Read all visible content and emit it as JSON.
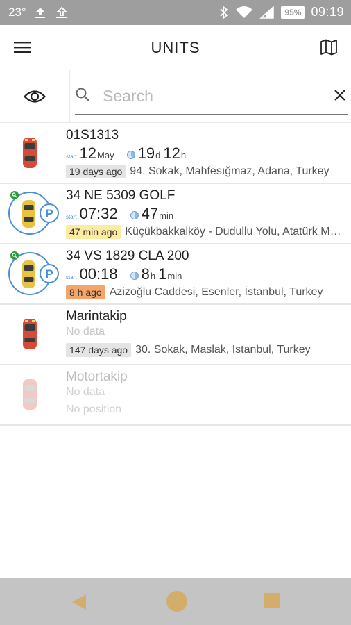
{
  "status_bar": {
    "temperature": "23°",
    "battery": "95%",
    "time": "09:19"
  },
  "app_bar": {
    "title": "UNITS",
    "menu_icon": "hamburger-menu-icon",
    "map_icon": "map-icon"
  },
  "search": {
    "placeholder": "Search",
    "value": "",
    "visibility_icon": "eye-icon",
    "search_icon": "search-icon",
    "clear_icon": "close-icon"
  },
  "units": [
    {
      "name": "01S1313",
      "start_label": "start",
      "start_main": "12",
      "start_sub": "May",
      "dur_main1": "19",
      "dur_sub1": "d",
      "dur_main2": "12",
      "dur_sub2": "h",
      "age": "19 days ago",
      "age_style": "neutral",
      "address": "94. Sokak, Mahfesığmaz, Adana, Turkey",
      "car_color": "red",
      "parked": false
    },
    {
      "name": "34 NE 5309 GOLF",
      "start_label": "start",
      "start_main": "07:32",
      "start_sub": "",
      "dur_main1": "47",
      "dur_sub1": "min",
      "dur_main2": "",
      "dur_sub2": "",
      "age": "47 min ago",
      "age_style": "warn",
      "address": "Küçükbakkalköy - Dudullu Yolu, Atatürk Mahallesi",
      "car_color": "yellow",
      "parked": true
    },
    {
      "name": "34 VS 1829 CLA 200",
      "start_label": "start",
      "start_main": "00:18",
      "start_sub": "",
      "dur_main1": "8",
      "dur_sub1": "h",
      "dur_main2": "1",
      "dur_sub2": "min",
      "age": "8 h ago",
      "age_style": "alert",
      "address": "Azizoğlu Caddesi, Esenler, İstanbul, Turkey",
      "car_color": "yellow",
      "parked": true
    },
    {
      "name": "Marintakip",
      "no_data": "No data",
      "age": "147 days ago",
      "age_style": "neutral",
      "address": "30. Sokak, Maslak, İstanbul, Turkey",
      "car_color": "red",
      "parked": false
    },
    {
      "name": "Motortakip",
      "no_data": "No data",
      "no_position": "No position",
      "car_color": "pale",
      "parked": false
    }
  ],
  "nav_bar": {
    "back_icon": "back-triangle-icon",
    "home_icon": "home-circle-icon",
    "recent_icon": "recent-square-icon"
  },
  "colors": {
    "status_bar": "#9e9e9e",
    "nav_bar": "#c4c4c4",
    "nav_buttons": "#d2ae6a",
    "badge_warn": "#fdeca0",
    "badge_alert": "#f5a56a",
    "badge_neutral": "#e4e4e4",
    "accent_blue": "#4a90d9",
    "online_green": "#2e9a3c"
  }
}
